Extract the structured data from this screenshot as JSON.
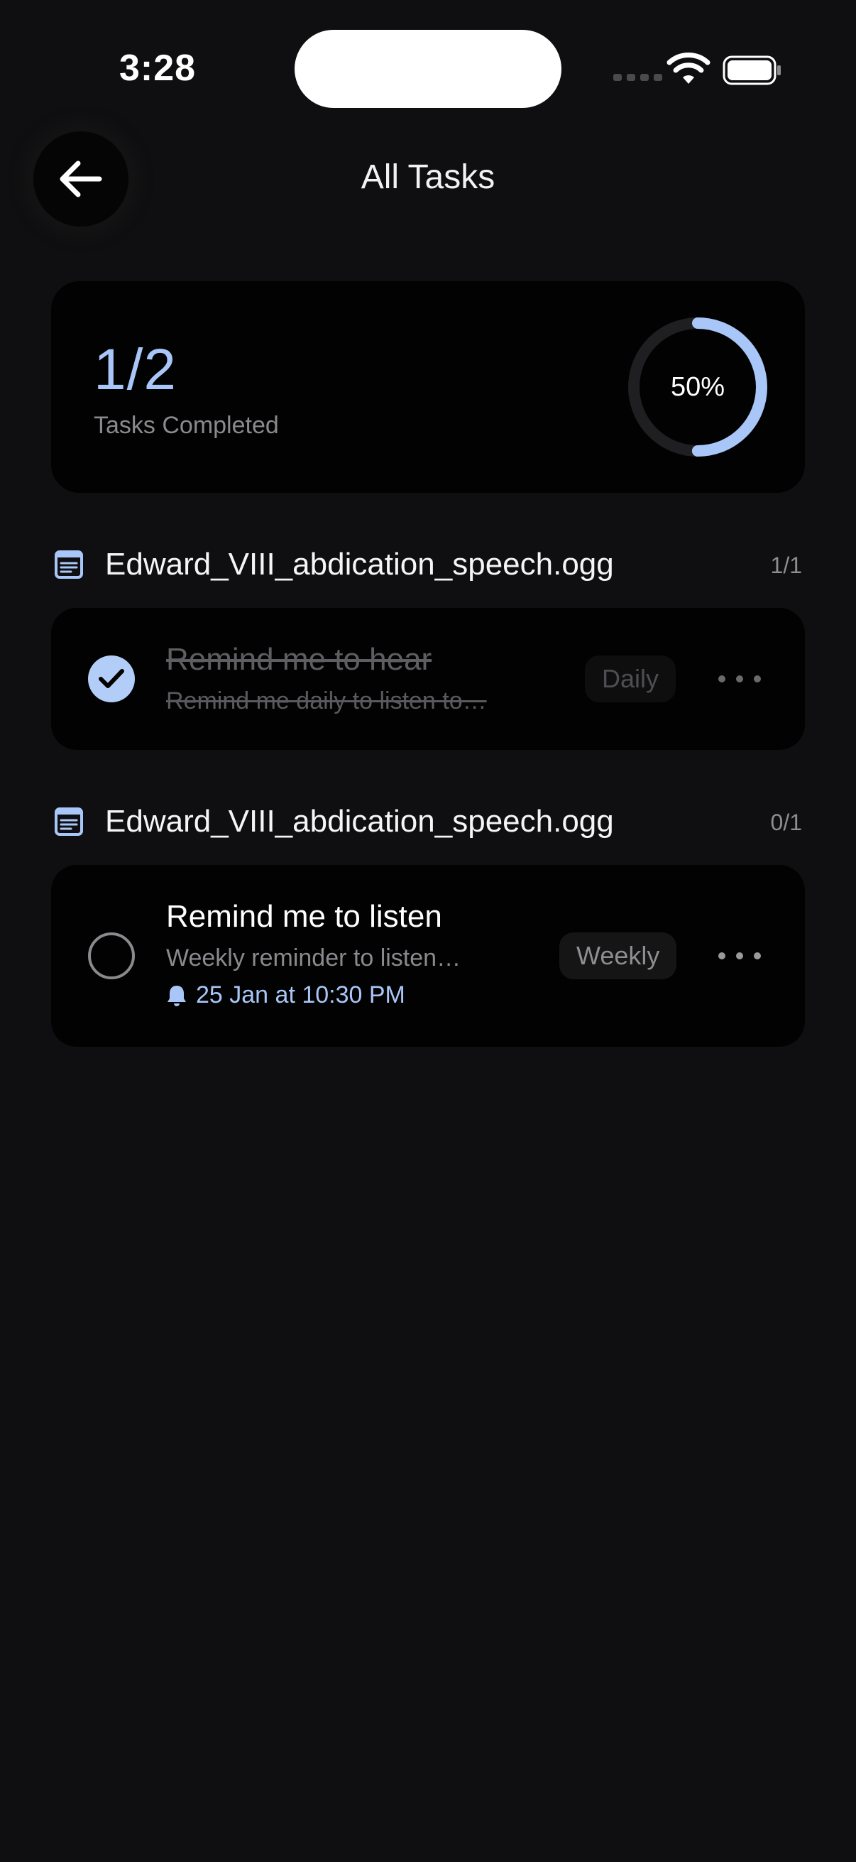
{
  "status_bar": {
    "time": "3:28"
  },
  "header": {
    "title": "All Tasks"
  },
  "summary": {
    "count": "1/2",
    "label": "Tasks Completed",
    "percent_label": "50%",
    "percent_value": 50,
    "colors": {
      "accent": "#a9c6f8",
      "track": "#1f1f21"
    }
  },
  "groups": [
    {
      "name": "Edward_VIII_abdication_speech.ogg",
      "count": "1/1",
      "icon": "document-icon",
      "task": {
        "title": "Remind me to hear",
        "description": "Remind me daily to listen to…",
        "frequency": "Daily",
        "completed": true,
        "reminder": ""
      }
    },
    {
      "name": "Edward_VIII_abdication_speech.ogg",
      "count": "0/1",
      "icon": "document-icon",
      "task": {
        "title": "Remind me to listen",
        "description": "Weekly reminder to listen…",
        "frequency": "Weekly",
        "completed": false,
        "reminder": "25 Jan at 10:30 PM"
      }
    }
  ]
}
